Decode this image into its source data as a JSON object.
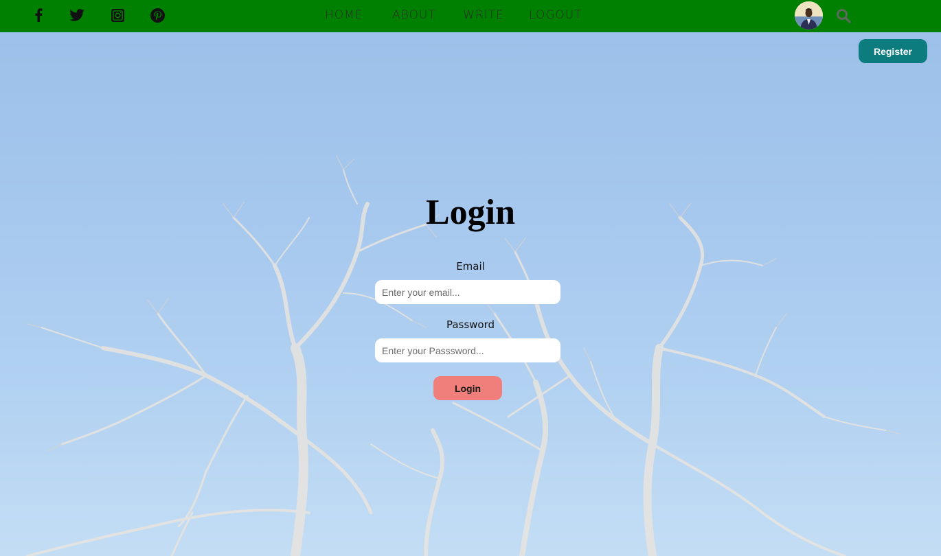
{
  "topbar": {
    "social": [
      {
        "name": "facebook-icon"
      },
      {
        "name": "twitter-icon"
      },
      {
        "name": "instagram-icon"
      },
      {
        "name": "pinterest-icon"
      }
    ],
    "nav": [
      {
        "label": "HOME"
      },
      {
        "label": "ABOUT"
      },
      {
        "label": "WRITE"
      },
      {
        "label": "LOGOUT"
      }
    ],
    "search_icon": "search-icon",
    "avatar": "user-avatar"
  },
  "register_label": "Register",
  "login": {
    "title": "Login",
    "email_label": "Email",
    "email_placeholder": "Enter your email...",
    "password_label": "Password",
    "password_placeholder": "Enter your Passsword...",
    "button_label": "Login"
  },
  "colors": {
    "topbar": "#008000",
    "register_button": "#0c7c7e",
    "login_button": "#f07f7b"
  }
}
